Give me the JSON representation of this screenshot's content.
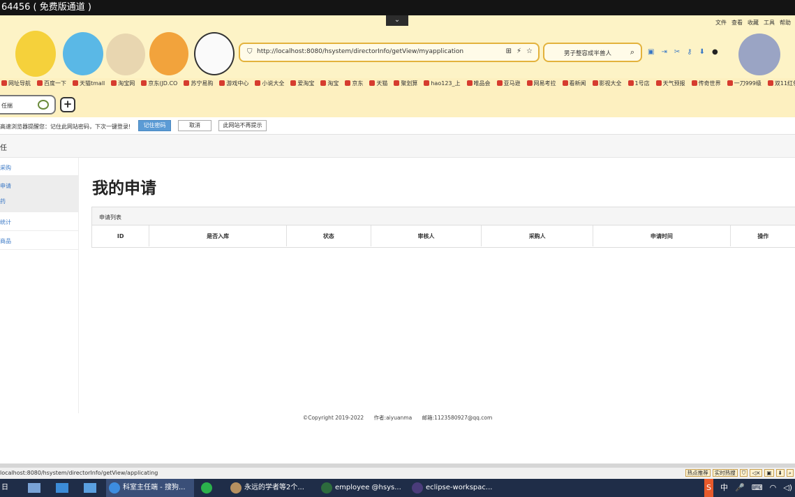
{
  "recorder": {
    "title": "64456 ( 免费版通道 )"
  },
  "browser": {
    "menu": [
      "文件",
      "查看",
      "收藏",
      "工具",
      "帮助"
    ],
    "url": "http://localhost:8080/hsystem/directorInfo/getView/myapplication",
    "search_text": "男子整容成半兽人",
    "bookmarks": [
      "网址导航",
      "百度一下",
      "天猫tmall",
      "淘宝网",
      "京东(JD.CO",
      "苏宁易购",
      "游戏中心",
      "小说大全",
      "爱淘宝",
      "淘宝",
      "京东",
      "天猫",
      "聚划算",
      "hao123_上",
      "唯品会",
      "亚马逊",
      "网易考拉",
      "看新闻",
      "影视大全",
      "1号店",
      "天气预报",
      "传奇世界",
      "一刀999级",
      "双11红包"
    ],
    "tab_label": "任揣",
    "new_tab": "+",
    "status_url": "localhost:8080/hsystem/directorInfo/getView/applicating",
    "status_badges": [
      "热点推荐",
      "实时热搜"
    ]
  },
  "password_prompt": {
    "message": "高速浏览器提醒您：记住此网站密码，下次一键登录!",
    "remember": "记住密码",
    "cancel": "取消",
    "never": "此网站不再提示"
  },
  "app": {
    "header_title": "任",
    "sidebar": [
      {
        "label": "采购"
      },
      {
        "label": "申请"
      },
      {
        "label": "药"
      },
      {
        "label": "统计"
      },
      {
        "label": "商品"
      }
    ],
    "page_title": "我的申请",
    "panel_title": "申请列表",
    "columns": [
      "ID",
      "是否入库",
      "状态",
      "审核人",
      "采购人",
      "申请时间",
      "操作"
    ],
    "footer": {
      "copyright": "©Copyright 2019-2022",
      "author": "作者:aiyuanma",
      "email": "邮箱:1123580927@qq.com"
    }
  },
  "taskbar": {
    "items": [
      {
        "label": "科室主任端 - 搜狗...",
        "active": true
      },
      {
        "label": ""
      },
      {
        "label": "永远的学者等2个..."
      },
      {
        "label": "employee @hsys..."
      },
      {
        "label": "eclipse-workspac..."
      }
    ],
    "ime": "中"
  },
  "colors": {
    "theme_bg": "#fdf0c0",
    "accent": "#5b9bd5",
    "link": "#3a78c5",
    "taskbar": "#1f2d48"
  }
}
